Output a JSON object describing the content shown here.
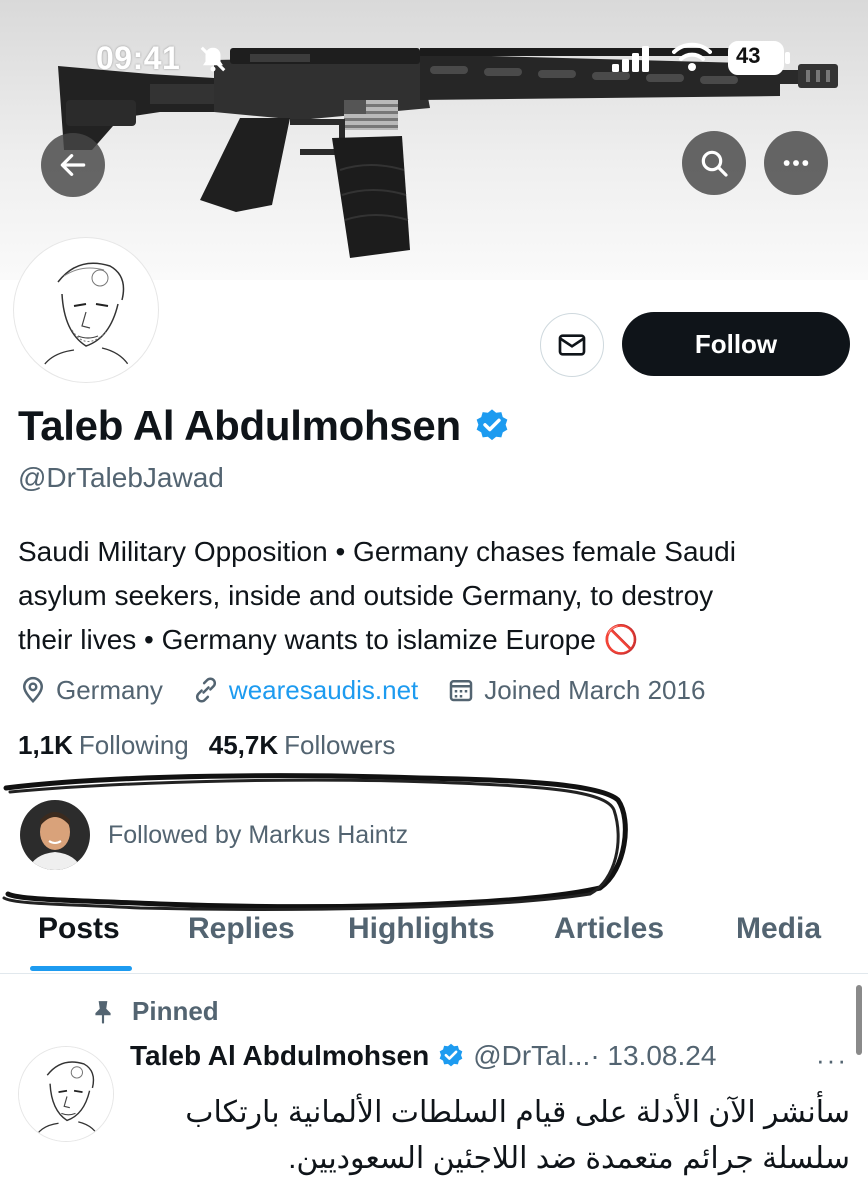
{
  "status_bar": {
    "time": "09:41",
    "battery": "43"
  },
  "profile": {
    "name": "Taleb Al Abdulmohsen",
    "handle": "@DrTalebJawad",
    "bio_line1": "Saudi Military Opposition • Germany chases female Saudi",
    "bio_line2": "asylum seekers, inside and outside Germany, to destroy",
    "bio_line3": "their lives • Germany wants to islamize Europe 🚫",
    "location": "Germany",
    "website": "wearesaudis.net",
    "joined": "Joined March 2016",
    "following_count": "1,1K",
    "following_label": "Following",
    "followers_count": "45,7K",
    "followers_label": "Followers",
    "followed_by": "Followed by Markus Haintz",
    "verified_color": "#1d9bf0"
  },
  "actions": {
    "follow_label": "Follow"
  },
  "tabs": [
    {
      "label": "Posts",
      "active": true
    },
    {
      "label": "Replies",
      "active": false
    },
    {
      "label": "Highlights",
      "active": false
    },
    {
      "label": "Articles",
      "active": false
    },
    {
      "label": "Media",
      "active": false
    }
  ],
  "pinned_post": {
    "pinned_label": "Pinned",
    "author_name": "Taleb Al Abdulmohsen",
    "author_handle": "@DrTal...",
    "date": "· 13.08.24",
    "more": "···",
    "text_line1": "سأنشر الآن الأدلة على قيام السلطات الألمانية بارتكاب",
    "text_line2": "سلسلة جرائم متعمدة ضد اللاجئين السعوديين."
  },
  "icons": [
    "back-arrow-icon",
    "search-icon",
    "more-icon",
    "mail-icon",
    "verified-icon",
    "location-icon",
    "link-icon",
    "calendar-icon",
    "pin-icon",
    "bell-muted-icon",
    "signal-icon",
    "wifi-icon",
    "battery-icon"
  ],
  "colors": {
    "accent": "#1d9bf0",
    "text": "#0f1419",
    "secondary": "#536471",
    "follow_bg": "#0f1419"
  }
}
